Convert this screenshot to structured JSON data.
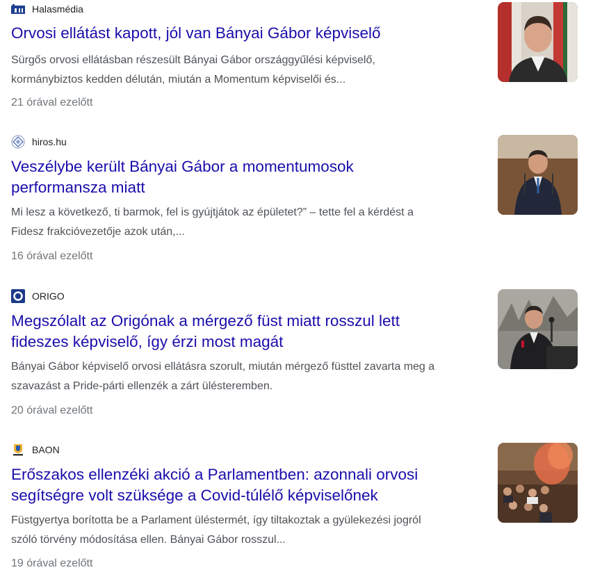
{
  "items": [
    {
      "source": "Halasmédia",
      "favicon": "hm-logo-icon",
      "title": "Orvosi ellátást kapott, jól van Bányai Gábor képviselő",
      "snippet_lines": [
        "Sürgős orvosi ellátásban részesült Bányai Gábor országgyűlési képviselő,",
        "kormánybiztos kedden délután, miután a Momentum képviselői és..."
      ],
      "time": "21 órával ezelőtt"
    },
    {
      "source": "hiros.hu",
      "favicon": "hiros-logo-icon",
      "title_lines": [
        "Veszélybe került Bányai Gábor a momentumosok",
        "performansza miatt"
      ],
      "snippet_lines": [
        "Mi lesz a következő, ti barmok, fel is gyújtjátok az épületet?” – tette fel a kérdést a",
        "Fidesz frakcióvezetője azok után,..."
      ],
      "time": "16 órával ezelőtt"
    },
    {
      "source": "ORIGO",
      "favicon": "origo-logo-icon",
      "title_lines": [
        "Megszólalt az Origónak a mérgező füst miatt rosszul lett",
        "fideszes képviselő, így érzi most magát"
      ],
      "snippet_lines": [
        "Bányai Gábor képviselő orvosi ellátásra szorult, miután mérgező füsttel zavarta meg a",
        "szavazást a Pride-párti ellenzék a zárt ülésteremben."
      ],
      "time": "20 órával ezelőtt"
    },
    {
      "source": "BAON",
      "favicon": "baon-logo-icon",
      "title_lines": [
        "Erőszakos ellenzéki akció a Parlamentben: azonnali orvosi",
        "segítségre volt szüksége a Covid-túlélő képviselőnek"
      ],
      "snippet_lines": [
        "Füstgyertya borította be a Parlament üléstermét, így tiltakoztak a gyülekezési jogról",
        "szóló törvény módosítása ellen. Bányai Gábor rosszul..."
      ],
      "time": "19 órával ezelőtt"
    }
  ],
  "colors": {
    "title": "#1a0dab",
    "snippet": "#4d5156",
    "time": "#70757a",
    "source": "#202124"
  }
}
